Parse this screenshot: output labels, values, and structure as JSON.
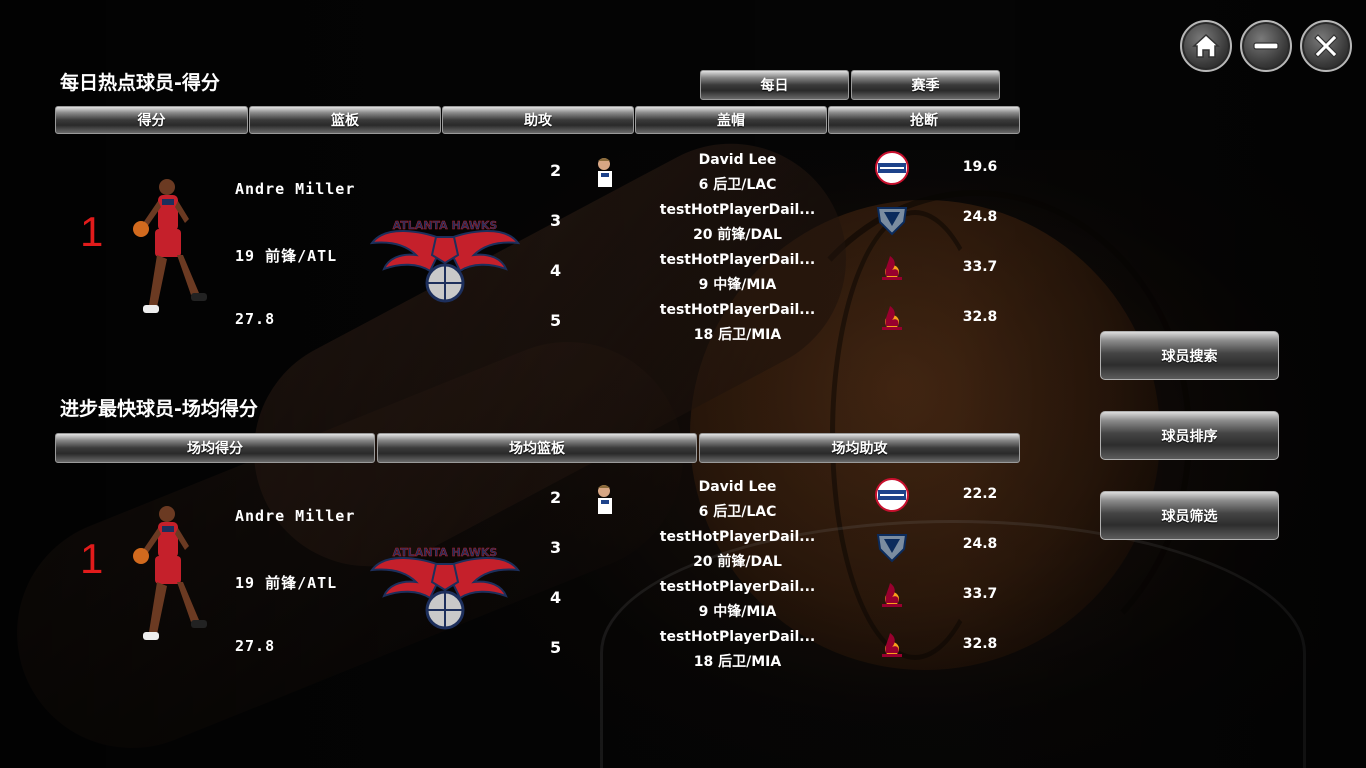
{
  "window_controls": {
    "home": "home-icon",
    "minimize": "minimize-icon",
    "close": "close-icon"
  },
  "daily_hot": {
    "title": "每日热点球员-得分",
    "period_tabs": [
      "每日",
      "赛季"
    ],
    "stat_tabs": [
      "得分",
      "篮板",
      "助攻",
      "盖帽",
      "抢断"
    ],
    "top": {
      "rank": "1",
      "name": "Andre Miller",
      "info": "19 前锋/ATL",
      "value": "27.8",
      "team_logo_text": "ATLANTA HAWKS"
    },
    "rows": [
      {
        "rank": "2",
        "name": "David Lee",
        "info": "6 后卫/LAC",
        "team": "clippers",
        "value": "19.6"
      },
      {
        "rank": "3",
        "name": "testHotPlayerDail...",
        "info": "20 前锋/DAL",
        "team": "mavericks",
        "value": "24.8"
      },
      {
        "rank": "4",
        "name": "testHotPlayerDail...",
        "info": "9 中锋/MIA",
        "team": "heat",
        "value": "33.7"
      },
      {
        "rank": "5",
        "name": "testHotPlayerDail...",
        "info": "18 后卫/MIA",
        "team": "heat",
        "value": "32.8"
      }
    ]
  },
  "most_improved": {
    "title": "进步最快球员-场均得分",
    "stat_tabs": [
      "场均得分",
      "场均篮板",
      "场均助攻"
    ],
    "top": {
      "rank": "1",
      "name": "Andre Miller",
      "info": "19 前锋/ATL",
      "value": "27.8",
      "team_logo_text": "ATLANTA HAWKS"
    },
    "rows": [
      {
        "rank": "2",
        "name": "David Lee",
        "info": "6 后卫/LAC",
        "team": "clippers",
        "value": "22.2"
      },
      {
        "rank": "3",
        "name": "testHotPlayerDail...",
        "info": "20 前锋/DAL",
        "team": "mavericks",
        "value": "24.8"
      },
      {
        "rank": "4",
        "name": "testHotPlayerDail...",
        "info": "9 中锋/MIA",
        "team": "heat",
        "value": "33.7"
      },
      {
        "rank": "5",
        "name": "testHotPlayerDail...",
        "info": "18 后卫/MIA",
        "team": "heat",
        "value": "32.8"
      }
    ]
  },
  "side_menu": [
    "球员搜索",
    "球员排序",
    "球员筛选"
  ],
  "colors": {
    "rank_red": "#e21b1b",
    "hawks_red": "#d22a36",
    "hawks_navy": "#1d2f5c",
    "clippers_blue": "#1d428a",
    "heat_red": "#98002e"
  }
}
